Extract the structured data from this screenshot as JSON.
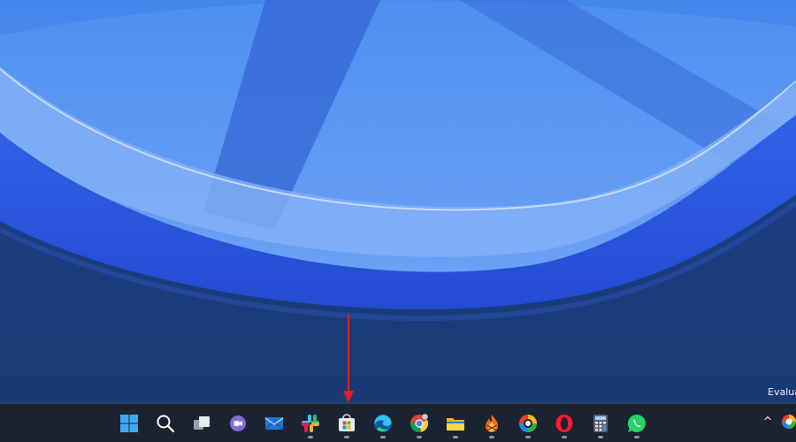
{
  "desktop": {
    "watermark_text": "Evalua"
  },
  "taskbar": {
    "apps": [
      {
        "name": "start",
        "icon": "windows-logo-icon",
        "running": false
      },
      {
        "name": "search",
        "icon": "search-icon",
        "running": false
      },
      {
        "name": "task-view",
        "icon": "task-view-icon",
        "running": false
      },
      {
        "name": "chat",
        "icon": "teams-chat-icon",
        "running": false
      },
      {
        "name": "mail",
        "icon": "mail-icon",
        "running": false
      },
      {
        "name": "slack",
        "icon": "slack-icon",
        "running": true
      },
      {
        "name": "microsoft-store",
        "icon": "store-bag-icon",
        "running": true
      },
      {
        "name": "edge",
        "icon": "edge-icon",
        "running": true
      },
      {
        "name": "chrome",
        "icon": "chrome-icon",
        "running": true
      },
      {
        "name": "file-explorer",
        "icon": "folder-icon",
        "running": true
      },
      {
        "name": "fire-app",
        "icon": "flame-app-icon",
        "running": true
      },
      {
        "name": "colorful-ring-app",
        "icon": "ring-app-icon",
        "running": true
      },
      {
        "name": "opera",
        "icon": "opera-icon",
        "running": true
      },
      {
        "name": "calculator",
        "icon": "calculator-icon",
        "running": true
      },
      {
        "name": "whatsapp",
        "icon": "whatsapp-icon",
        "running": true
      }
    ],
    "tray": {
      "chevron": "^",
      "icon": "ring-app-tray-icon"
    }
  },
  "colors": {
    "taskbar_bg": "#1c2330",
    "arrow": "#e02020",
    "accent": "#0078d4"
  }
}
